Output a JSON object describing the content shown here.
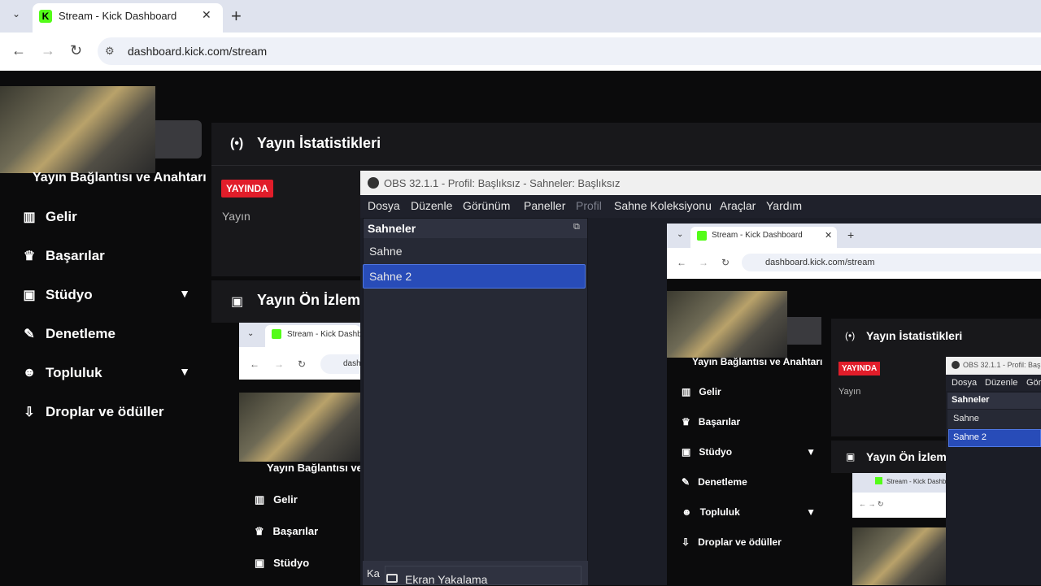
{
  "browser": {
    "tab_title": "Stream - Kick Dashboard",
    "tab_icon": "K",
    "url": "dashboard.kick.com/stream"
  },
  "sidebar": {
    "connection_label": "Yayın Bağlantısı ve Anahtarı",
    "items": [
      {
        "label": "Gelir",
        "icon": "chart-icon"
      },
      {
        "label": "Başarılar",
        "icon": "trophy-icon"
      },
      {
        "label": "Stüdyo",
        "icon": "studio-icon"
      },
      {
        "label": "Denetleme",
        "icon": "wrench-icon"
      },
      {
        "label": "Topluluk",
        "icon": "community-icon"
      },
      {
        "label": "Droplar ve ödüller",
        "icon": "drops-icon"
      }
    ]
  },
  "stats": {
    "title": "Yayın İstatistikleri",
    "live_badge": "YAYINDA",
    "label": "Yayın"
  },
  "preview": {
    "title": "Yayın Ön İzlem"
  },
  "obs": {
    "title": "OBS 32.1.1 - Profil: Başlıksız - Sahneler: Başlıksız",
    "menu": [
      "Dosya",
      "Düzenle",
      "Görünüm",
      "Paneller",
      "Profil",
      "Sahne Koleksiyonu",
      "Araçlar",
      "Yardım"
    ],
    "scenes_header": "Sahneler",
    "scenes": [
      "Sahne",
      "Sahne 2"
    ],
    "selected_scene": "Sahne 2",
    "sources_prefix": "Ka",
    "popup_item": "Ekran Yakalama"
  },
  "nested": {
    "tab_title": "Stream - Kick Dashboard",
    "url": "dashboard.kick.com/stream",
    "stats_title": "Yayın İstatistikleri",
    "live_badge": "YAYINDA",
    "label": "Yayın",
    "connection_label": "Yayın Bağlantısı ve Anahtarı",
    "preview_title": "Yayın Ön İzlem",
    "obs_title": "OBS 32.1.1 - Profil: Baş",
    "obs_menu": [
      "Dosya",
      "Düzenle",
      "Gör"
    ],
    "scenes_header": "Sahneler",
    "scenes": [
      "Sahne",
      "Sahne 2"
    ],
    "inner_tab_title": "Stream - Kick Dashb",
    "inner_url": "dash",
    "inner_connection_label": "Yayın Bağlantısı ve",
    "inner_items": [
      "Gelir",
      "Başarılar",
      "Stüdyo"
    ],
    "inner_deep_tab_title": "Stream - Kick Dashb"
  }
}
